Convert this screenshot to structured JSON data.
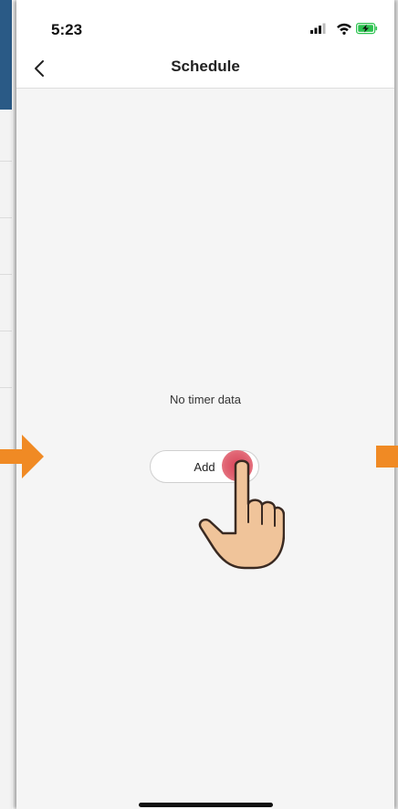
{
  "status_bar": {
    "time": "5:23",
    "icons": [
      "signal-icon",
      "wifi-icon",
      "battery-charging-icon"
    ]
  },
  "nav": {
    "back_icon": "chevron-left-icon",
    "title": "Schedule"
  },
  "content": {
    "empty_message": "No timer data",
    "add_button_label": "Add"
  },
  "colors": {
    "accent_arrow": "#f08a24",
    "tap_indicator": "#d9455a",
    "left_panel_header": "#2a5a86"
  }
}
